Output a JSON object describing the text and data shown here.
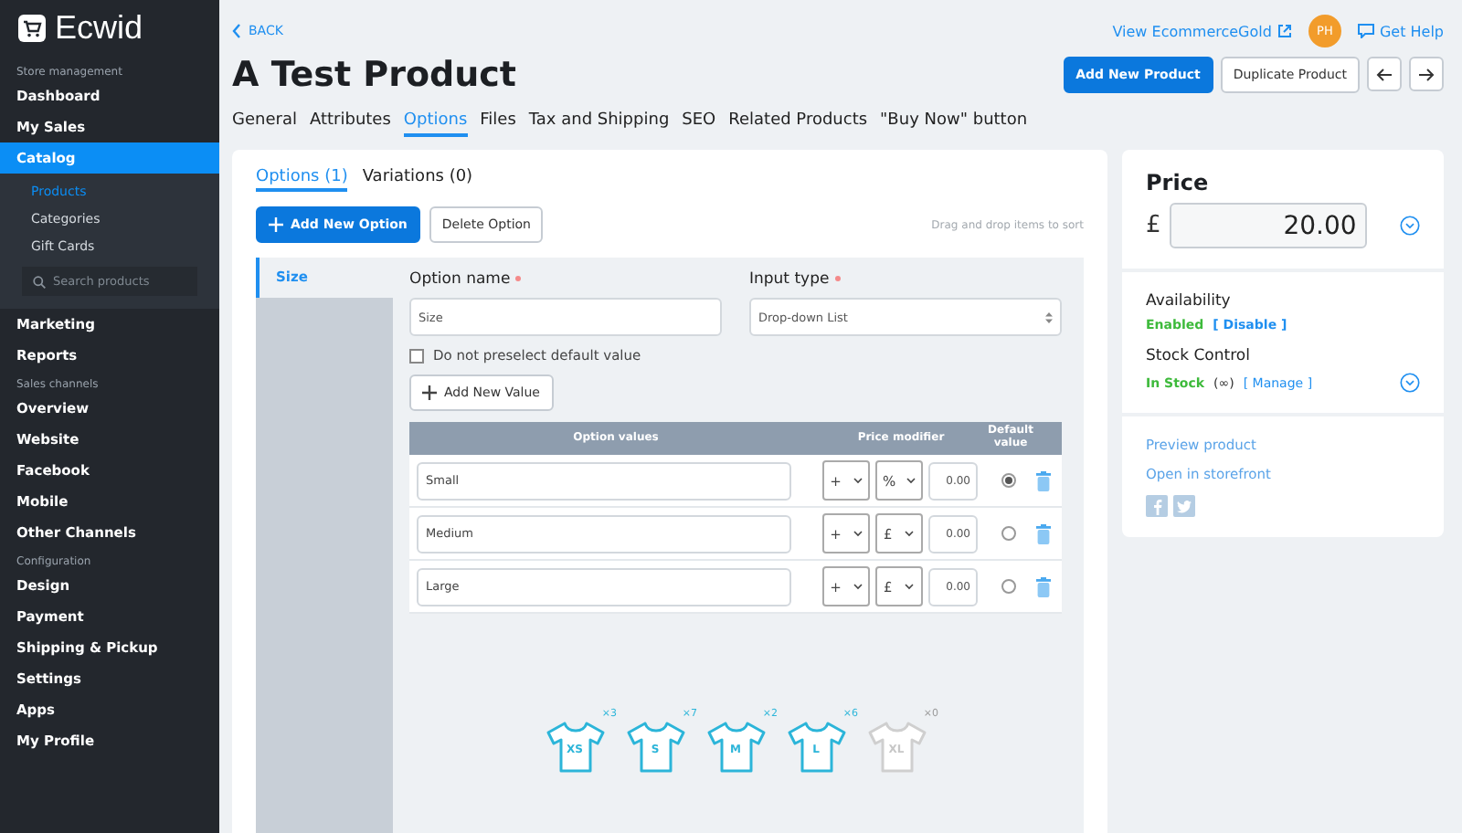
{
  "sidebar": {
    "logo": "Ecwid",
    "sections": [
      {
        "heading": "Store management",
        "items": [
          {
            "label": "Dashboard",
            "selected": false
          },
          {
            "label": "My Sales",
            "selected": false
          },
          {
            "label": "Catalog",
            "selected": true,
            "children": [
              {
                "label": "Products",
                "selected": true
              },
              {
                "label": "Categories",
                "selected": false
              },
              {
                "label": "Gift Cards",
                "selected": false
              }
            ],
            "search_placeholder": "Search products"
          },
          {
            "label": "Marketing",
            "selected": false
          },
          {
            "label": "Reports",
            "selected": false
          }
        ]
      },
      {
        "heading": "Sales channels",
        "items": [
          {
            "label": "Overview",
            "selected": false
          },
          {
            "label": "Website",
            "selected": false
          },
          {
            "label": "Facebook",
            "selected": false
          },
          {
            "label": "Mobile",
            "selected": false
          },
          {
            "label": "Other Channels",
            "selected": false
          }
        ]
      },
      {
        "heading": "Configuration",
        "items": [
          {
            "label": "Design",
            "selected": false
          },
          {
            "label": "Payment",
            "selected": false
          },
          {
            "label": "Shipping & Pickup",
            "selected": false
          },
          {
            "label": "Settings",
            "selected": false
          },
          {
            "label": "Apps",
            "selected": false
          },
          {
            "label": "My Profile",
            "selected": false
          }
        ]
      }
    ]
  },
  "header": {
    "back": "BACK",
    "title": "A Test Product",
    "store_link": "View EcommerceGold",
    "avatar": "PH",
    "help": "Get Help",
    "buttons": [
      "Add New Product",
      "Duplicate Product"
    ]
  },
  "tabs": [
    {
      "label": "General",
      "selected": false
    },
    {
      "label": "Attributes",
      "selected": false
    },
    {
      "label": "Options",
      "selected": true
    },
    {
      "label": "Files",
      "selected": false
    },
    {
      "label": "Tax and Shipping",
      "selected": false
    },
    {
      "label": "SEO",
      "selected": false
    },
    {
      "label": "Related Products",
      "selected": false
    },
    {
      "label": "\"Buy Now\" button",
      "selected": false
    }
  ],
  "options_panel": {
    "subtabs": [
      {
        "label": "Options (1)",
        "selected": true
      },
      {
        "label": "Variations (0)",
        "selected": false
      }
    ],
    "add_option": "Add New Option",
    "delete_option": "Delete Option",
    "hint": "Drag and drop items to sort",
    "options": [
      {
        "label": "Size",
        "selected": true
      }
    ],
    "option_name_label": "Option name",
    "option_name": "Size",
    "input_type_label": "Input type",
    "input_type": "Drop-down List",
    "no_preselect": {
      "label": "Do not preselect default value",
      "checked": false
    },
    "add_value": "Add New Value",
    "columns": [
      "Option values",
      "Price modifier",
      "Default value"
    ],
    "values": [
      {
        "name": "Small",
        "sign": "+",
        "unit": "%",
        "amount": "0.00",
        "selected": true
      },
      {
        "name": "Medium",
        "sign": "+",
        "unit": "£",
        "amount": "0.00",
        "selected": false
      },
      {
        "name": "Large",
        "sign": "+",
        "unit": "£",
        "amount": "0.00",
        "selected": false
      }
    ],
    "shirts": [
      {
        "size": "XS",
        "count": "×3",
        "in_stock": true
      },
      {
        "size": "S",
        "count": "×7",
        "in_stock": true
      },
      {
        "size": "M",
        "count": "×2",
        "in_stock": true
      },
      {
        "size": "L",
        "count": "×6",
        "in_stock": true
      },
      {
        "size": "XL",
        "count": "×0",
        "in_stock": false
      }
    ]
  },
  "price_card": {
    "title": "Price",
    "currency": "£",
    "price": "20.00",
    "availability_label": "Availability",
    "availability": "Enabled",
    "disable": "[ Disable ]",
    "stock_label": "Stock Control",
    "stock": "In Stock",
    "stock_qty": "(∞)",
    "manage": "[ Manage ]",
    "links": [
      "Preview product",
      "Open in storefront"
    ]
  }
}
